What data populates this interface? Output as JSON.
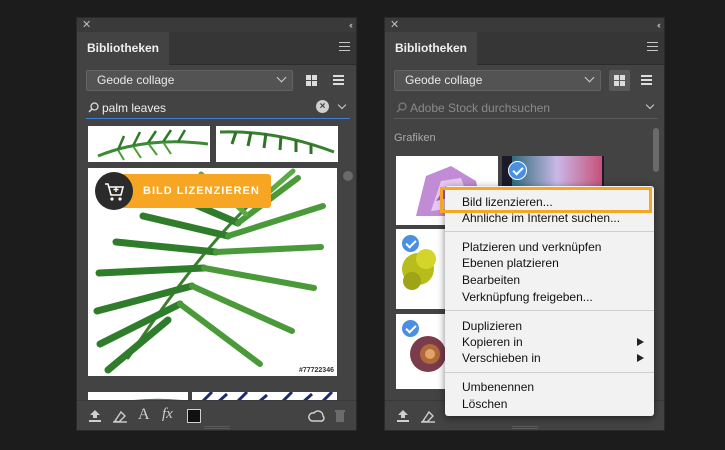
{
  "panels": [
    {
      "title": "Bibliotheken",
      "library": "Geode collage",
      "search_value": "palm leaves",
      "search_placeholder": "",
      "license_button": "BILD LIZENZIEREN",
      "stock_id": "#77722346"
    },
    {
      "title": "Bibliotheken",
      "library": "Geode collage",
      "search_value": "",
      "search_placeholder": "Adobe Stock durchsuchen",
      "section": "Grafiken"
    }
  ],
  "context_menu": {
    "items": [
      {
        "label": "Bild lizenzieren..."
      },
      {
        "label": "Ähnliche im Internet suchen..."
      },
      {
        "label": "Platzieren und verknüpfen"
      },
      {
        "label": "Ebenen platzieren"
      },
      {
        "label": "Bearbeiten"
      },
      {
        "label": "Verknüpfung freigeben..."
      },
      {
        "label": "Duplizieren"
      },
      {
        "label": "Kopieren in"
      },
      {
        "label": "Verschieben in"
      },
      {
        "label": "Umbenennen"
      },
      {
        "label": "Löschen"
      }
    ]
  },
  "colors": {
    "accent_orange": "#f6a623",
    "check_blue": "#4a8fe0",
    "panel_bg": "#434343",
    "page_bg": "#1c1c1c"
  }
}
